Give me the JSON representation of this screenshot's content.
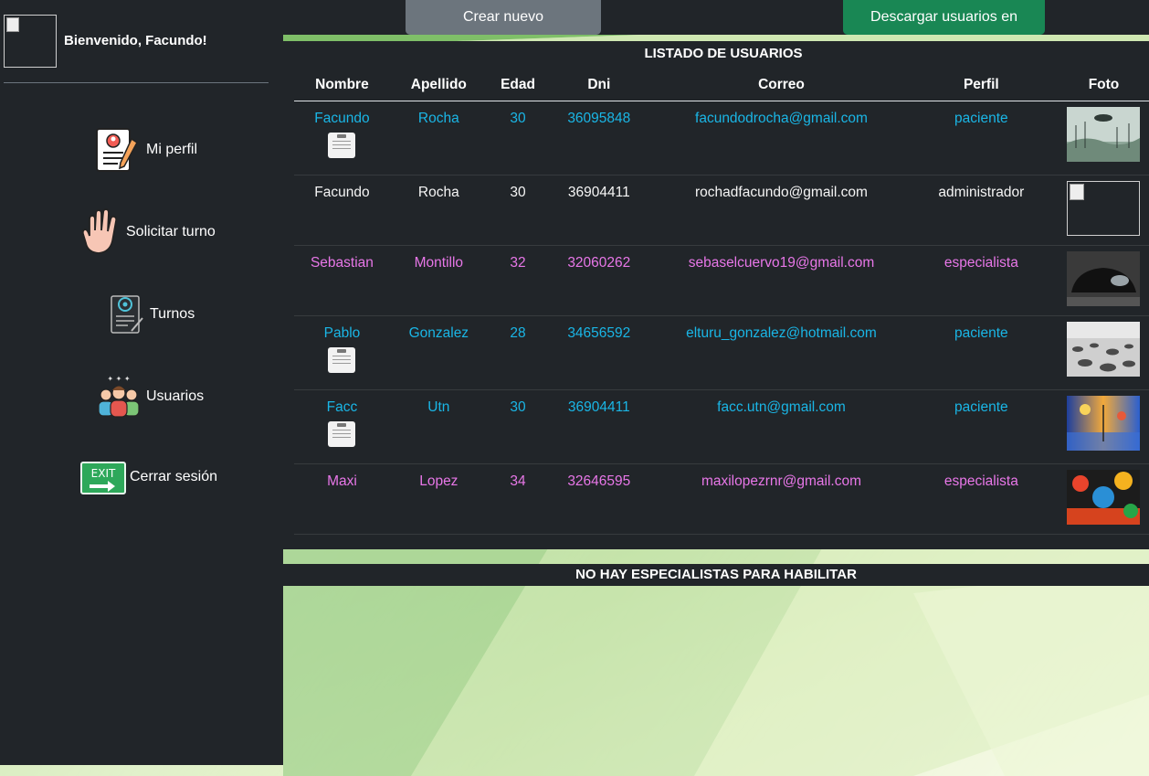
{
  "toolbar": {
    "create_admin_label": "Crear nuevo administrador",
    "download_excel_label": "Descargar usuarios en Excel"
  },
  "sidebar": {
    "welcome": "Bienvenido, Facundo!",
    "items": [
      {
        "label": "Mi perfil",
        "icon": "profile-document-icon"
      },
      {
        "label": "Solicitar turno",
        "icon": "hand-icon"
      },
      {
        "label": "Turnos",
        "icon": "turnos-document-icon"
      },
      {
        "label": "Usuarios",
        "icon": "users-group-icon"
      },
      {
        "label": "Cerrar sesión",
        "icon": "exit-sign-icon"
      }
    ]
  },
  "users_table": {
    "title": "LISTADO DE USUARIOS",
    "headers": [
      "Nombre",
      "Apellido",
      "Edad",
      "Dni",
      "Correo",
      "Perfil",
      "Foto"
    ],
    "rows": [
      {
        "nombre": "Facundo",
        "apellido": "Rocha",
        "edad": "30",
        "dni": "36095848",
        "correo": "facundodrocha@gmail.com",
        "perfil": "paciente",
        "color": "#1ab6e6",
        "has_history_icon": true,
        "photo": "landscape-photo"
      },
      {
        "nombre": "Facundo",
        "apellido": "Rocha",
        "edad": "30",
        "dni": "36904411",
        "correo": "rochadfacundo@gmail.com",
        "perfil": "administrador",
        "color": "#f5f5f5",
        "has_history_icon": false,
        "photo": "broken-image"
      },
      {
        "nombre": "Sebastian",
        "apellido": "Montillo",
        "edad": "32",
        "dni": "32060262",
        "correo": "sebaselcuervo19@gmail.com",
        "perfil": "especialista",
        "color": "#e877e8",
        "has_history_icon": false,
        "photo": "car-photo"
      },
      {
        "nombre": "Pablo",
        "apellido": "Gonzalez",
        "edad": "28",
        "dni": "34656592",
        "correo": "elturu_gonzalez@hotmail.com",
        "perfil": "paciente",
        "color": "#1ab6e6",
        "has_history_icon": true,
        "photo": "stones-photo"
      },
      {
        "nombre": "Facc",
        "apellido": "Utn",
        "edad": "30",
        "dni": "36904411",
        "correo": "facc.utn@gmail.com",
        "perfil": "paciente",
        "color": "#1ab6e6",
        "has_history_icon": true,
        "photo": "painting-photo"
      },
      {
        "nombre": "Maxi",
        "apellido": "Lopez",
        "edad": "34",
        "dni": "32646595",
        "correo": "maxilopezrnr@gmail.com",
        "perfil": "especialista",
        "color": "#e877e8",
        "has_history_icon": false,
        "photo": "painting-photo-2"
      }
    ]
  },
  "notice": "NO HAY ESPECIALISTAS PARA HABILITAR"
}
